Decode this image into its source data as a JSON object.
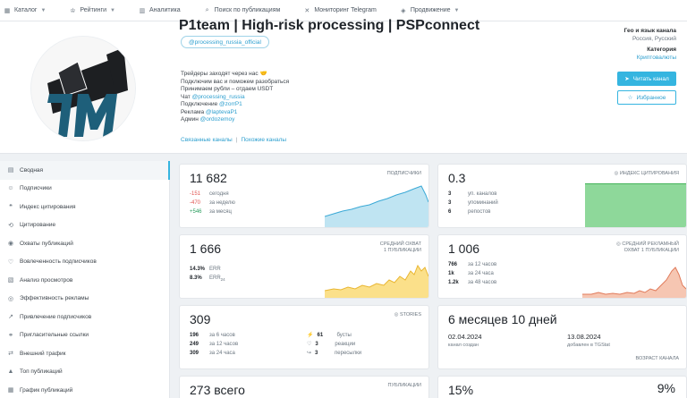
{
  "nav": [
    {
      "label": "Каталог",
      "icon": "grid-icon",
      "chev": true
    },
    {
      "label": "Рейтинги",
      "icon": "trophy-icon",
      "chev": true
    },
    {
      "label": "Аналитика",
      "icon": "chart-icon",
      "chev": false
    },
    {
      "label": "Поиск по публикациям",
      "icon": "search-doc-icon",
      "chev": false
    },
    {
      "label": "Мониторинг Telegram",
      "icon": "monitor-icon",
      "chev": false
    },
    {
      "label": "Продвижение",
      "icon": "megaphone-icon",
      "chev": true
    }
  ],
  "channel": {
    "title": "P1team | High-risk processing | PSPconnect",
    "username": "@processing_russia_official",
    "desc": [
      {
        "text": "Трейдеры заходят через нас 🤝",
        "link": ""
      },
      {
        "text": "Подключим вас и поможем разобраться",
        "link": ""
      },
      {
        "text": "Принимаем рубли – отдаем USDT",
        "link": ""
      },
      {
        "text": "Чат ",
        "link": "@processing_russia"
      },
      {
        "text": "Подключение ",
        "link": "@zorrP1"
      },
      {
        "text": "Реклама ",
        "link": "@laptevaP1"
      },
      {
        "text": "Админ ",
        "link": "@ordozemoy"
      }
    ],
    "related_label": "Связанные каналы",
    "similar_label": "Похожие каналы",
    "geo_label": "Гео и язык канала",
    "geo_value": "Россия, Русский",
    "category_label": "Категория",
    "category_value": "Криптовалюты",
    "read_button": "Читать канал",
    "fav_button": "Избранное"
  },
  "sidebar": [
    {
      "label": "Сводная",
      "icon": "doc-icon",
      "active": true
    },
    {
      "label": "Подписчики",
      "icon": "users-icon"
    },
    {
      "label": "Индекс цитирования",
      "icon": "quote-icon"
    },
    {
      "label": "Цитирование",
      "icon": "citation-icon"
    },
    {
      "label": "Охваты публикаций",
      "icon": "eye-icon"
    },
    {
      "label": "Вовлеченность подписчиков",
      "icon": "heart-icon"
    },
    {
      "label": "Анализ просмотров",
      "icon": "analysis-icon"
    },
    {
      "label": "Эффективность рекламы",
      "icon": "target-icon"
    },
    {
      "label": "Привлечение подписчиков",
      "icon": "growth-icon"
    },
    {
      "label": "Пригласительные ссылки",
      "icon": "link-icon"
    },
    {
      "label": "Внешний трафик",
      "icon": "traffic-icon"
    },
    {
      "label": "Топ публикаций",
      "icon": "top-icon"
    },
    {
      "label": "График публикаций",
      "icon": "calendar-icon"
    }
  ],
  "cards": {
    "subs": {
      "big": "11 682",
      "tag": "ПОДПИСЧИКИ",
      "rows": [
        {
          "n": "-151",
          "t": "сегодня",
          "cls": "neg"
        },
        {
          "n": "-470",
          "t": "за неделю",
          "cls": "neg"
        },
        {
          "n": "+546",
          "t": "за месяц",
          "cls": "pos"
        }
      ]
    },
    "cite": {
      "big": "0.3",
      "tag": "ИНДЕКС ЦИТИРОВАНИЯ",
      "rows": [
        {
          "n": "3",
          "t": "уп. каналов"
        },
        {
          "n": "3",
          "t": "упоминаний"
        },
        {
          "n": "6",
          "t": "репостов"
        }
      ]
    },
    "reach": {
      "big": "1 666",
      "tag1": "СРЕДНИЙ ОХВАТ",
      "tag2": "1 ПУБЛИКАЦИИ",
      "rows": [
        {
          "n": "14.3%",
          "t": "ERR"
        },
        {
          "n": "8.3%",
          "t": "ERR",
          "sub": "24"
        }
      ]
    },
    "adreach": {
      "big": "1 006",
      "tag1": "СРЕДНИЙ РЕКЛАМНЫЙ",
      "tag2": "ОХВАТ 1 ПУБЛИКАЦИИ",
      "rows": [
        {
          "n": "766",
          "t": "за 12 часов"
        },
        {
          "n": "1k",
          "t": "за 24 часа"
        },
        {
          "n": "1.2k",
          "t": "за 48 часов"
        }
      ]
    },
    "stories": {
      "big": "309",
      "tag": "STORIES",
      "rows": [
        {
          "n": "196",
          "t": "за 6 часов"
        },
        {
          "n": "249",
          "t": "за 12 часов"
        },
        {
          "n": "309",
          "t": "за 24 часа"
        }
      ],
      "rows2": [
        {
          "n": "61",
          "t": "бусты",
          "icon": "boost-icon"
        },
        {
          "n": "3",
          "t": "реакции",
          "icon": "reaction-icon"
        },
        {
          "n": "3",
          "t": "пересылки",
          "icon": "forward-icon"
        }
      ]
    },
    "age": {
      "big": "6 месяцев 10 дней",
      "created_date": "02.04.2024",
      "created_label": "канал создан",
      "added_date": "13.08.2024",
      "added_label": "добавлен в TGStat",
      "tag": "ВОЗРАСТ КАНАЛА"
    },
    "pubs": {
      "big": "273 всего",
      "tag": "ПУБЛИКАЦИИ"
    },
    "last": {
      "left": "15%",
      "right": "9%"
    }
  },
  "colors": {
    "accent": "#35b5e0",
    "subs_fill": "#bfe4f2",
    "cite_fill": "#8ed89a",
    "reach_fill": "#fbe08a",
    "ad_fill": "#f6c6b2"
  }
}
